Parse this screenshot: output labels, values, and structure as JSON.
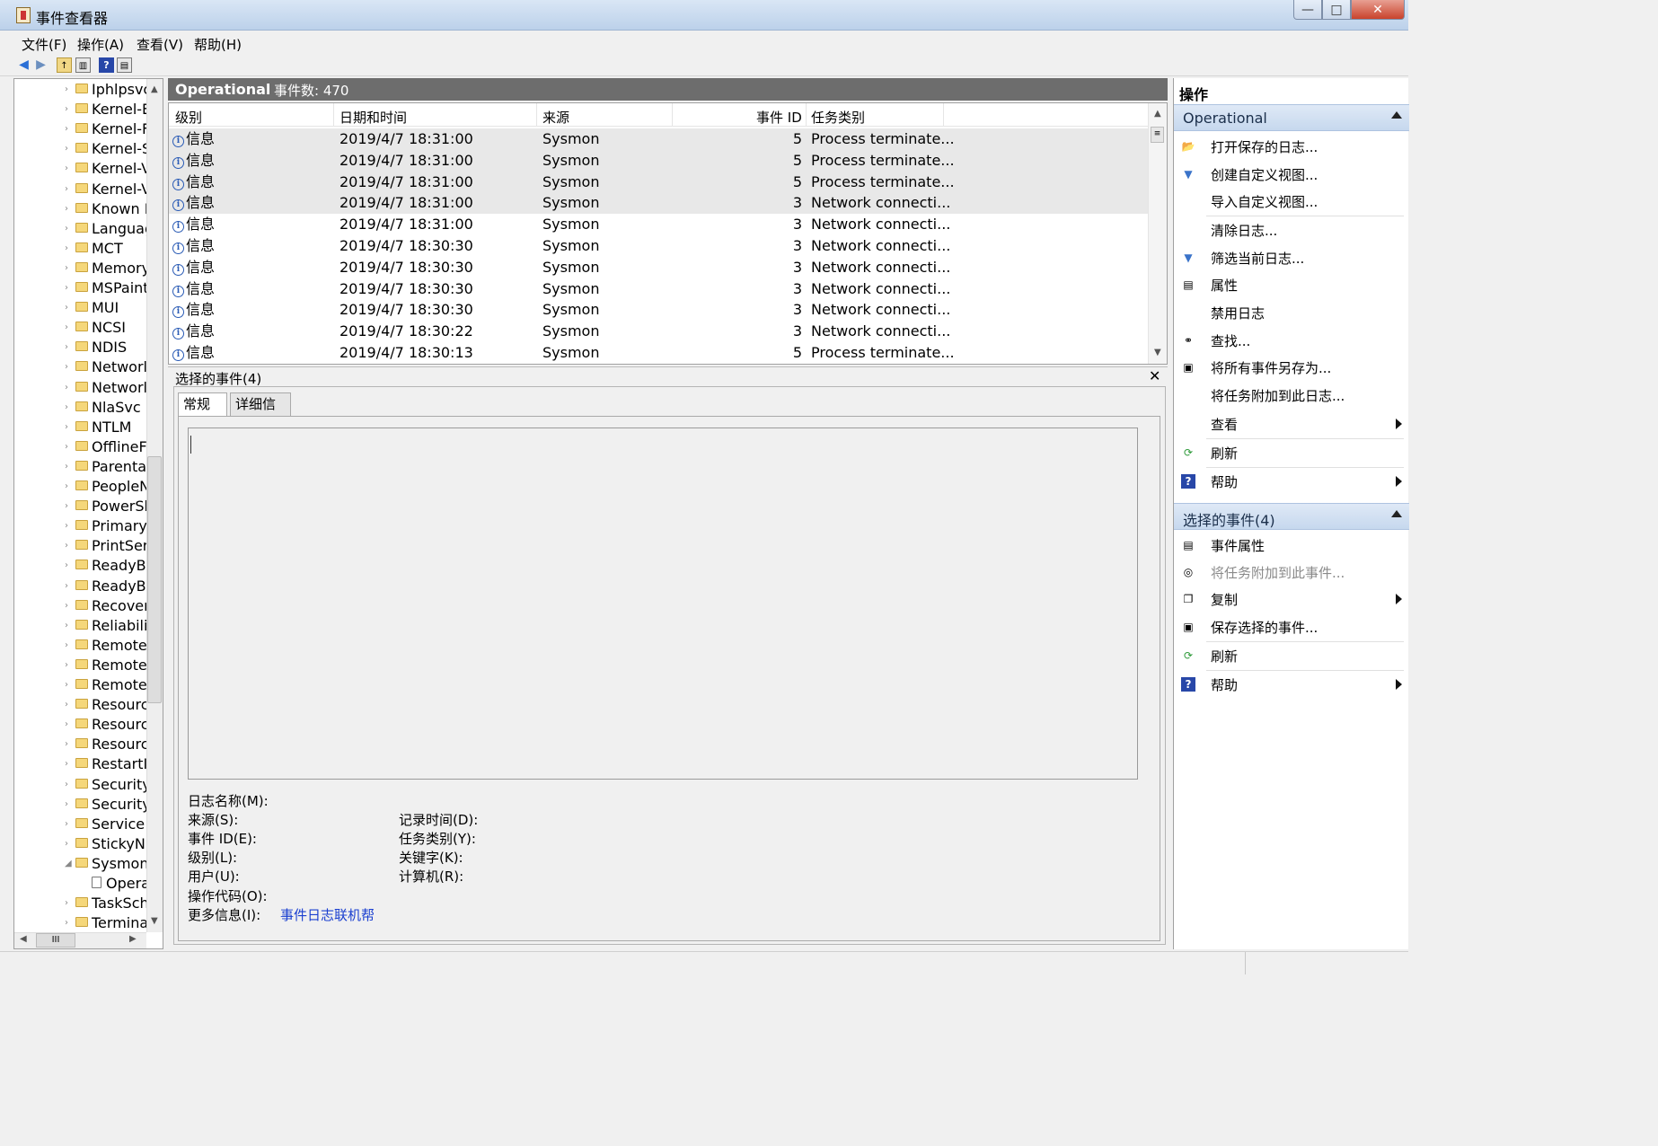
{
  "window": {
    "title": "事件查看器",
    "minimize": "—",
    "maximize": "□",
    "close": "✕"
  },
  "menu": [
    "文件(F)",
    "操作(A)",
    "查看(V)",
    "帮助(H)"
  ],
  "tree": {
    "items": [
      {
        "label": "Iphlpsvc",
        "arrow": "›"
      },
      {
        "label": "Kernel-E",
        "arrow": "›"
      },
      {
        "label": "Kernel-F",
        "arrow": "›"
      },
      {
        "label": "Kernel-S",
        "arrow": "›"
      },
      {
        "label": "Kernel-V",
        "arrow": "›"
      },
      {
        "label": "Kernel-V",
        "arrow": "›"
      },
      {
        "label": "Known F",
        "arrow": "›"
      },
      {
        "label": "Languag",
        "arrow": "›"
      },
      {
        "label": "MCT",
        "arrow": "›"
      },
      {
        "label": "Memory",
        "arrow": "›"
      },
      {
        "label": "MSPaint",
        "arrow": "›"
      },
      {
        "label": "MUI",
        "arrow": "›"
      },
      {
        "label": "NCSI",
        "arrow": "›"
      },
      {
        "label": "NDIS",
        "arrow": "›"
      },
      {
        "label": "Networl",
        "arrow": "›"
      },
      {
        "label": "Networl",
        "arrow": "›"
      },
      {
        "label": "NlaSvc",
        "arrow": "›"
      },
      {
        "label": "NTLM",
        "arrow": "›"
      },
      {
        "label": "OfflineF",
        "arrow": "›"
      },
      {
        "label": "Parenta",
        "arrow": "›"
      },
      {
        "label": "PeopleN",
        "arrow": "›"
      },
      {
        "label": "PowerSh",
        "arrow": "›"
      },
      {
        "label": "Primary",
        "arrow": "›"
      },
      {
        "label": "PrintSer",
        "arrow": "›"
      },
      {
        "label": "ReadyBo",
        "arrow": "›"
      },
      {
        "label": "ReadyBo",
        "arrow": "›"
      },
      {
        "label": "Recover",
        "arrow": "›"
      },
      {
        "label": "Reliabili",
        "arrow": "›"
      },
      {
        "label": "Remote",
        "arrow": "›"
      },
      {
        "label": "Remote",
        "arrow": "›"
      },
      {
        "label": "Remote",
        "arrow": "›"
      },
      {
        "label": "Resourc",
        "arrow": "›"
      },
      {
        "label": "Resourc",
        "arrow": "›"
      },
      {
        "label": "Resourc",
        "arrow": "›"
      },
      {
        "label": "RestartI",
        "arrow": "›"
      },
      {
        "label": "Security",
        "arrow": "›"
      },
      {
        "label": "Security",
        "arrow": "›"
      },
      {
        "label": "Service",
        "arrow": "›"
      },
      {
        "label": "StickyN",
        "arrow": "›"
      },
      {
        "label": "Sysmon",
        "arrow": "◢"
      },
      {
        "label": "Opera",
        "arrow": "",
        "child": true
      },
      {
        "label": "TaskSch",
        "arrow": "›"
      },
      {
        "label": "Termina",
        "arrow": "›"
      }
    ],
    "hscroll_label": "III"
  },
  "center": {
    "title": "Operational",
    "count_label": "事件数: 470",
    "columns": [
      "级别",
      "日期和时间",
      "来源",
      "事件 ID",
      "任务类别"
    ],
    "rows": [
      {
        "level": "信息",
        "datetime": "2019/4/7 18:31:00",
        "source": "Sysmon",
        "id": "5",
        "task": "Process terminate...",
        "selected": true
      },
      {
        "level": "信息",
        "datetime": "2019/4/7 18:31:00",
        "source": "Sysmon",
        "id": "5",
        "task": "Process terminate...",
        "selected": true
      },
      {
        "level": "信息",
        "datetime": "2019/4/7 18:31:00",
        "source": "Sysmon",
        "id": "5",
        "task": "Process terminate...",
        "selected": true
      },
      {
        "level": "信息",
        "datetime": "2019/4/7 18:31:00",
        "source": "Sysmon",
        "id": "3",
        "task": "Network connecti...",
        "selected": true
      },
      {
        "level": "信息",
        "datetime": "2019/4/7 18:31:00",
        "source": "Sysmon",
        "id": "3",
        "task": "Network connecti...",
        "selected": false
      },
      {
        "level": "信息",
        "datetime": "2019/4/7 18:30:30",
        "source": "Sysmon",
        "id": "3",
        "task": "Network connecti...",
        "selected": false
      },
      {
        "level": "信息",
        "datetime": "2019/4/7 18:30:30",
        "source": "Sysmon",
        "id": "3",
        "task": "Network connecti...",
        "selected": false
      },
      {
        "level": "信息",
        "datetime": "2019/4/7 18:30:30",
        "source": "Sysmon",
        "id": "3",
        "task": "Network connecti...",
        "selected": false
      },
      {
        "level": "信息",
        "datetime": "2019/4/7 18:30:30",
        "source": "Sysmon",
        "id": "3",
        "task": "Network connecti...",
        "selected": false
      },
      {
        "level": "信息",
        "datetime": "2019/4/7 18:30:22",
        "source": "Sysmon",
        "id": "3",
        "task": "Network connecti...",
        "selected": false
      },
      {
        "level": "信息",
        "datetime": "2019/4/7 18:30:13",
        "source": "Sysmon",
        "id": "5",
        "task": "Process terminate...",
        "selected": false
      }
    ]
  },
  "detail": {
    "title": "选择的事件(4)",
    "close": "✕",
    "tabs": [
      "常规",
      "详细信息"
    ],
    "fields_left": [
      "日志名称(M):",
      "来源(S):",
      "事件 ID(E):",
      "级别(L):",
      "用户(U):",
      "操作代码(O):",
      "更多信息(I):"
    ],
    "fields_right": [
      "记录时间(D):",
      "任务类别(Y):",
      "关键字(K):",
      "计算机(R):"
    ],
    "more_info_link": "事件日志联机帮"
  },
  "actions": {
    "title": "操作",
    "section1": {
      "title": "Operational",
      "items": [
        {
          "label": "打开保存的日志...",
          "icon": "folder-open-icon",
          "glyph": "📂"
        },
        {
          "label": "创建自定义视图...",
          "icon": "filter-icon",
          "glyph": "▼"
        },
        {
          "label": "导入自定义视图...",
          "icon": "",
          "glyph": ""
        },
        {
          "label": "清除日志...",
          "icon": "",
          "glyph": ""
        },
        {
          "label": "筛选当前日志...",
          "icon": "filter-icon",
          "glyph": "▼"
        },
        {
          "label": "属性",
          "icon": "properties-icon",
          "glyph": "▤"
        },
        {
          "label": "禁用日志",
          "icon": "",
          "glyph": ""
        },
        {
          "label": "查找...",
          "icon": "binoculars-icon",
          "glyph": "⚭"
        },
        {
          "label": "将所有事件另存为...",
          "icon": "save-icon",
          "glyph": "▣"
        },
        {
          "label": "将任务附加到此日志...",
          "icon": "",
          "glyph": ""
        },
        {
          "label": "查看",
          "icon": "",
          "glyph": "",
          "submenu": true
        },
        {
          "label": "刷新",
          "icon": "refresh-icon",
          "glyph": "⟳"
        },
        {
          "label": "帮助",
          "icon": "help-icon",
          "glyph": "?",
          "submenu": true
        }
      ]
    },
    "section2": {
      "title": "选择的事件(4)",
      "items": [
        {
          "label": "事件属性",
          "icon": "properties-icon",
          "glyph": "▤"
        },
        {
          "label": "将任务附加到此事件...",
          "icon": "task-icon",
          "glyph": "◎",
          "disabled": true
        },
        {
          "label": "复制",
          "icon": "copy-icon",
          "glyph": "❐",
          "submenu": true
        },
        {
          "label": "保存选择的事件...",
          "icon": "save-icon",
          "glyph": "▣"
        },
        {
          "label": "刷新",
          "icon": "refresh-icon",
          "glyph": "⟳"
        },
        {
          "label": "帮助",
          "icon": "help-icon",
          "glyph": "?",
          "submenu": true
        }
      ]
    }
  },
  "colors": {
    "title_bar": "#bcd1ea",
    "center_header": "#6d6d6d",
    "section_header": "#c6d8ee",
    "link": "#1a3fd0",
    "info_icon": "#2a5bb5"
  }
}
